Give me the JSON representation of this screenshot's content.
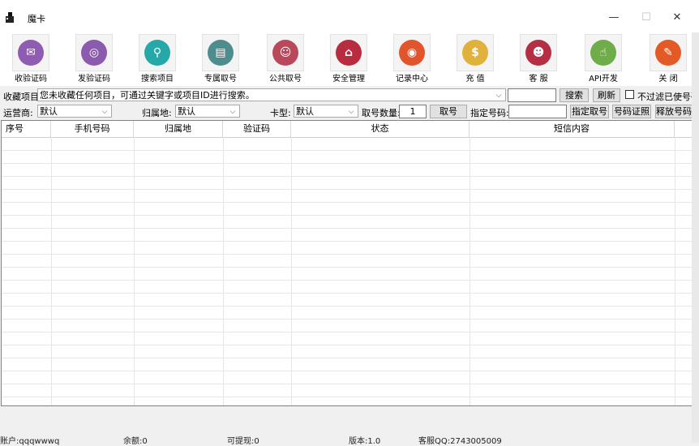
{
  "window": {
    "title": "魔卡",
    "minimize": "—",
    "maximize": "☐",
    "close": "✕"
  },
  "toolbar": [
    {
      "label": "收验证码",
      "color": "#8e5cb0",
      "glyph": "✉"
    },
    {
      "label": "发验证码",
      "color": "#8b5cad",
      "glyph": "◎"
    },
    {
      "label": "搜索项目",
      "color": "#27a8a8",
      "glyph": "⚲"
    },
    {
      "label": "专属取号",
      "color": "#4d8d8e",
      "glyph": "▤"
    },
    {
      "label": "公共取号",
      "color": "#b9495a",
      "glyph": "☺"
    },
    {
      "label": "安全管理",
      "color": "#b72c3e",
      "glyph": "⌂"
    },
    {
      "label": "记录中心",
      "color": "#e2542c",
      "glyph": "◉"
    },
    {
      "label": "充  值",
      "color": "#e0b23b",
      "glyph": "$"
    },
    {
      "label": "客  服",
      "color": "#b52f44",
      "glyph": "☻"
    },
    {
      "label": "API开发",
      "color": "#6fac4a",
      "glyph": "☝"
    },
    {
      "label": "关  闭",
      "color": "#e45a27",
      "glyph": "✎"
    }
  ],
  "search_row": {
    "label": "收藏项目",
    "combo_value": "您未收藏任何项目，可通过关键字或项目ID进行搜索。",
    "search_input_value": "",
    "search_button": "搜索",
    "refresh_button": "刷新",
    "filter_checkbox_label": "不过滤已使号码"
  },
  "filter_row": {
    "carrier_label": "运营商:",
    "carrier_value": "默认",
    "region_label": "归属地:",
    "region_value": "默认",
    "card_type_label": "卡型:",
    "card_type_value": "默认",
    "count_label": "取号数量:",
    "count_value": "1",
    "get_number_button": "取号",
    "specify_label": "指定号码:",
    "specify_input_value": "",
    "specify_get_button": "指定取号",
    "export_button": "号码证照",
    "release_button": "释放号码"
  },
  "table": {
    "columns": [
      "序号",
      "手机号码",
      "归属地",
      "验证码",
      "状态",
      "短信内容"
    ]
  },
  "statusbar": {
    "account": "账户:qqqwwwq",
    "balance": "余额:0",
    "withdrawable": "可提现:0",
    "version": "版本:1.0",
    "qq": "客服QQ:2743005009"
  }
}
